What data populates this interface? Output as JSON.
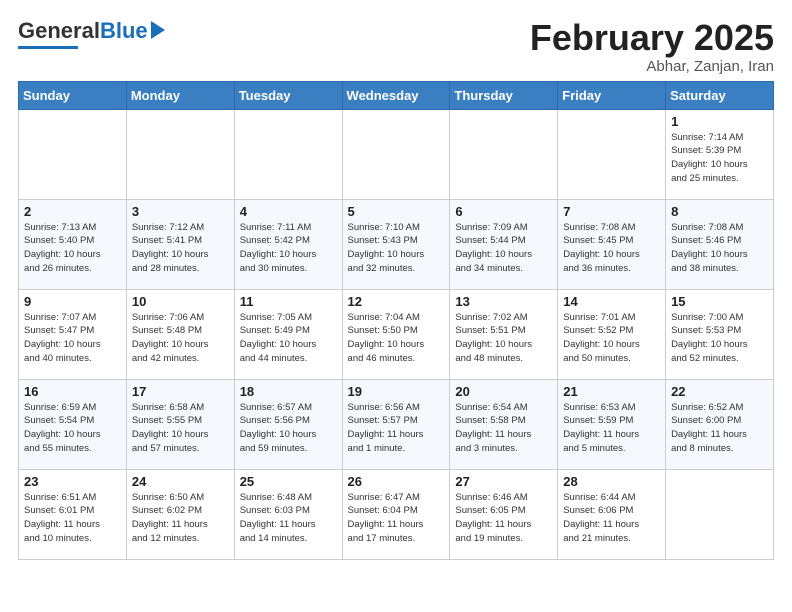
{
  "header": {
    "logo_general": "General",
    "logo_blue": "Blue",
    "month_title": "February 2025",
    "subtitle": "Abhar, Zanjan, Iran"
  },
  "weekdays": [
    "Sunday",
    "Monday",
    "Tuesday",
    "Wednesday",
    "Thursday",
    "Friday",
    "Saturday"
  ],
  "weeks": [
    [
      {
        "day": "",
        "info": ""
      },
      {
        "day": "",
        "info": ""
      },
      {
        "day": "",
        "info": ""
      },
      {
        "day": "",
        "info": ""
      },
      {
        "day": "",
        "info": ""
      },
      {
        "day": "",
        "info": ""
      },
      {
        "day": "1",
        "info": "Sunrise: 7:14 AM\nSunset: 5:39 PM\nDaylight: 10 hours\nand 25 minutes."
      }
    ],
    [
      {
        "day": "2",
        "info": "Sunrise: 7:13 AM\nSunset: 5:40 PM\nDaylight: 10 hours\nand 26 minutes."
      },
      {
        "day": "3",
        "info": "Sunrise: 7:12 AM\nSunset: 5:41 PM\nDaylight: 10 hours\nand 28 minutes."
      },
      {
        "day": "4",
        "info": "Sunrise: 7:11 AM\nSunset: 5:42 PM\nDaylight: 10 hours\nand 30 minutes."
      },
      {
        "day": "5",
        "info": "Sunrise: 7:10 AM\nSunset: 5:43 PM\nDaylight: 10 hours\nand 32 minutes."
      },
      {
        "day": "6",
        "info": "Sunrise: 7:09 AM\nSunset: 5:44 PM\nDaylight: 10 hours\nand 34 minutes."
      },
      {
        "day": "7",
        "info": "Sunrise: 7:08 AM\nSunset: 5:45 PM\nDaylight: 10 hours\nand 36 minutes."
      },
      {
        "day": "8",
        "info": "Sunrise: 7:08 AM\nSunset: 5:46 PM\nDaylight: 10 hours\nand 38 minutes."
      }
    ],
    [
      {
        "day": "9",
        "info": "Sunrise: 7:07 AM\nSunset: 5:47 PM\nDaylight: 10 hours\nand 40 minutes."
      },
      {
        "day": "10",
        "info": "Sunrise: 7:06 AM\nSunset: 5:48 PM\nDaylight: 10 hours\nand 42 minutes."
      },
      {
        "day": "11",
        "info": "Sunrise: 7:05 AM\nSunset: 5:49 PM\nDaylight: 10 hours\nand 44 minutes."
      },
      {
        "day": "12",
        "info": "Sunrise: 7:04 AM\nSunset: 5:50 PM\nDaylight: 10 hours\nand 46 minutes."
      },
      {
        "day": "13",
        "info": "Sunrise: 7:02 AM\nSunset: 5:51 PM\nDaylight: 10 hours\nand 48 minutes."
      },
      {
        "day": "14",
        "info": "Sunrise: 7:01 AM\nSunset: 5:52 PM\nDaylight: 10 hours\nand 50 minutes."
      },
      {
        "day": "15",
        "info": "Sunrise: 7:00 AM\nSunset: 5:53 PM\nDaylight: 10 hours\nand 52 minutes."
      }
    ],
    [
      {
        "day": "16",
        "info": "Sunrise: 6:59 AM\nSunset: 5:54 PM\nDaylight: 10 hours\nand 55 minutes."
      },
      {
        "day": "17",
        "info": "Sunrise: 6:58 AM\nSunset: 5:55 PM\nDaylight: 10 hours\nand 57 minutes."
      },
      {
        "day": "18",
        "info": "Sunrise: 6:57 AM\nSunset: 5:56 PM\nDaylight: 10 hours\nand 59 minutes."
      },
      {
        "day": "19",
        "info": "Sunrise: 6:56 AM\nSunset: 5:57 PM\nDaylight: 11 hours\nand 1 minute."
      },
      {
        "day": "20",
        "info": "Sunrise: 6:54 AM\nSunset: 5:58 PM\nDaylight: 11 hours\nand 3 minutes."
      },
      {
        "day": "21",
        "info": "Sunrise: 6:53 AM\nSunset: 5:59 PM\nDaylight: 11 hours\nand 5 minutes."
      },
      {
        "day": "22",
        "info": "Sunrise: 6:52 AM\nSunset: 6:00 PM\nDaylight: 11 hours\nand 8 minutes."
      }
    ],
    [
      {
        "day": "23",
        "info": "Sunrise: 6:51 AM\nSunset: 6:01 PM\nDaylight: 11 hours\nand 10 minutes."
      },
      {
        "day": "24",
        "info": "Sunrise: 6:50 AM\nSunset: 6:02 PM\nDaylight: 11 hours\nand 12 minutes."
      },
      {
        "day": "25",
        "info": "Sunrise: 6:48 AM\nSunset: 6:03 PM\nDaylight: 11 hours\nand 14 minutes."
      },
      {
        "day": "26",
        "info": "Sunrise: 6:47 AM\nSunset: 6:04 PM\nDaylight: 11 hours\nand 17 minutes."
      },
      {
        "day": "27",
        "info": "Sunrise: 6:46 AM\nSunset: 6:05 PM\nDaylight: 11 hours\nand 19 minutes."
      },
      {
        "day": "28",
        "info": "Sunrise: 6:44 AM\nSunset: 6:06 PM\nDaylight: 11 hours\nand 21 minutes."
      },
      {
        "day": "",
        "info": ""
      }
    ]
  ]
}
